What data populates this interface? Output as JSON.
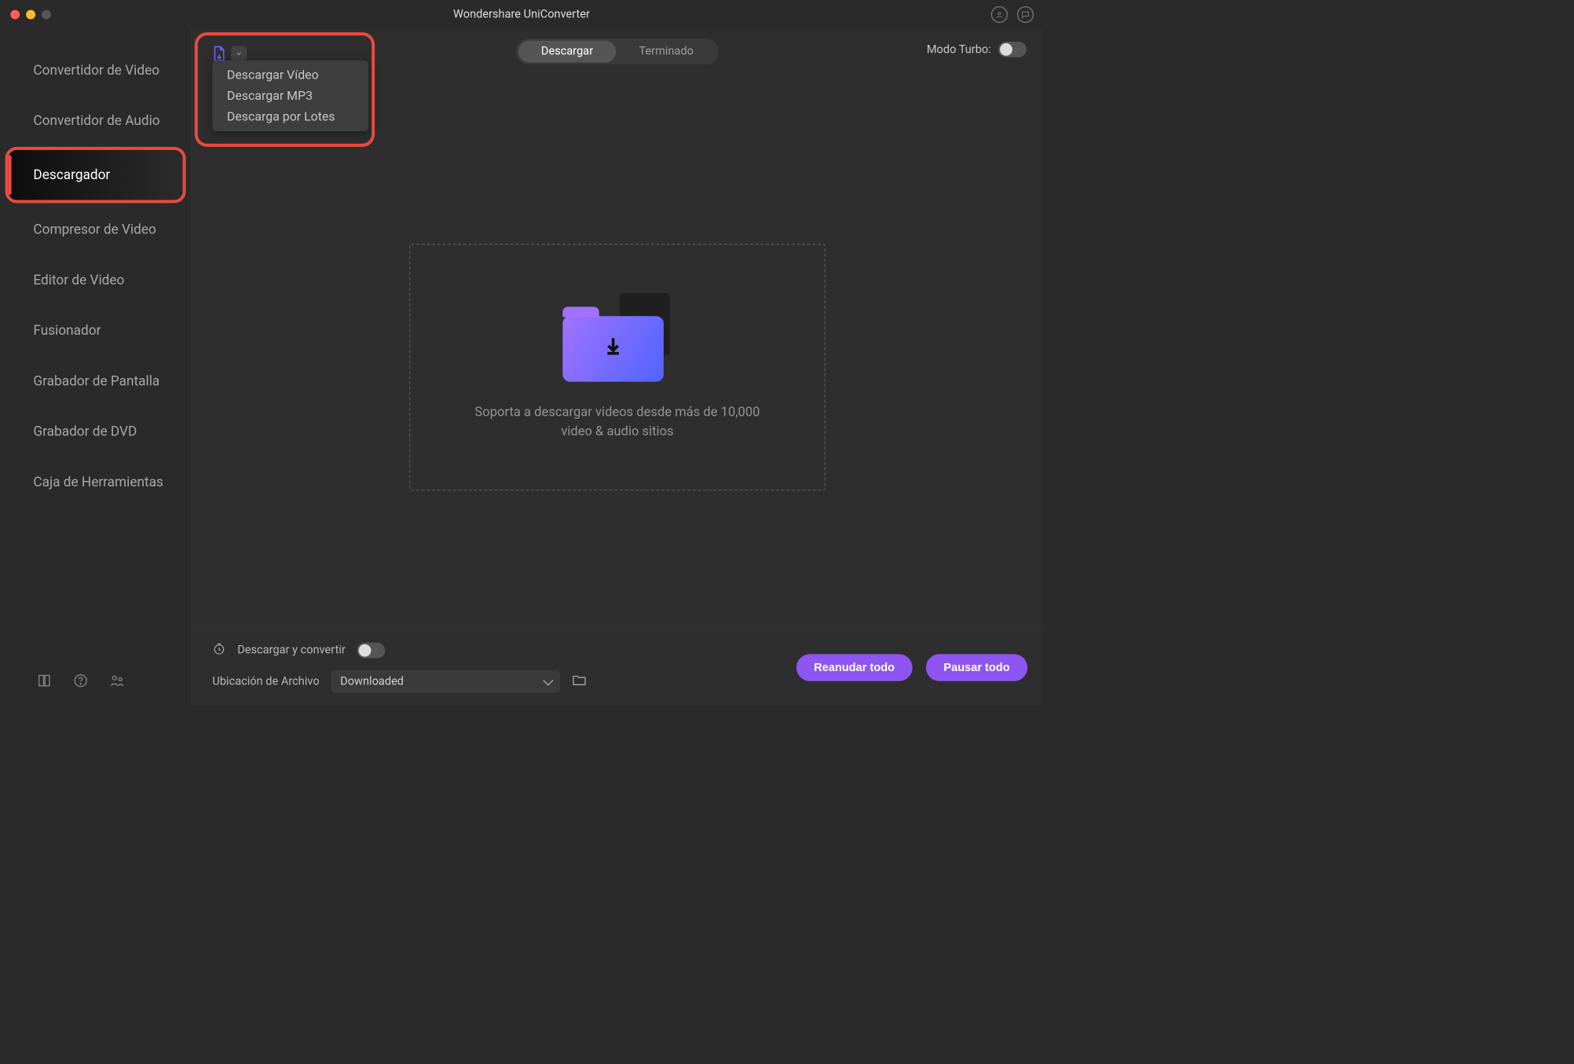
{
  "titlebar": {
    "title": "Wondershare UniConverter"
  },
  "sidebar": {
    "items": [
      {
        "label": "Convertidor de Video"
      },
      {
        "label": "Convertidor de Audio"
      },
      {
        "label": "Descargador"
      },
      {
        "label": "Compresor de Video"
      },
      {
        "label": "Editor de Video"
      },
      {
        "label": "Fusionador"
      },
      {
        "label": "Grabador de Pantalla"
      },
      {
        "label": "Grabador de DVD"
      },
      {
        "label": "Caja de Herramientas"
      }
    ]
  },
  "dropdown": {
    "items": [
      {
        "label": "Descargar Vídeo"
      },
      {
        "label": "Descargar MP3"
      },
      {
        "label": "Descarga por Lotes"
      }
    ]
  },
  "tabs": {
    "download": "Descargar",
    "finished": "Terminado"
  },
  "turbo": {
    "label": "Modo Turbo:"
  },
  "dropzone": {
    "line1": "Soporta a descargar videos desde más de 10,000",
    "line2": "video & audio sitios"
  },
  "footer": {
    "download_convert": "Descargar y convertir",
    "file_location_label": "Ubicación de Archivo",
    "file_location_value": "Downloaded",
    "resume_all": "Reanudar todo",
    "pause_all": "Pausar todo"
  }
}
